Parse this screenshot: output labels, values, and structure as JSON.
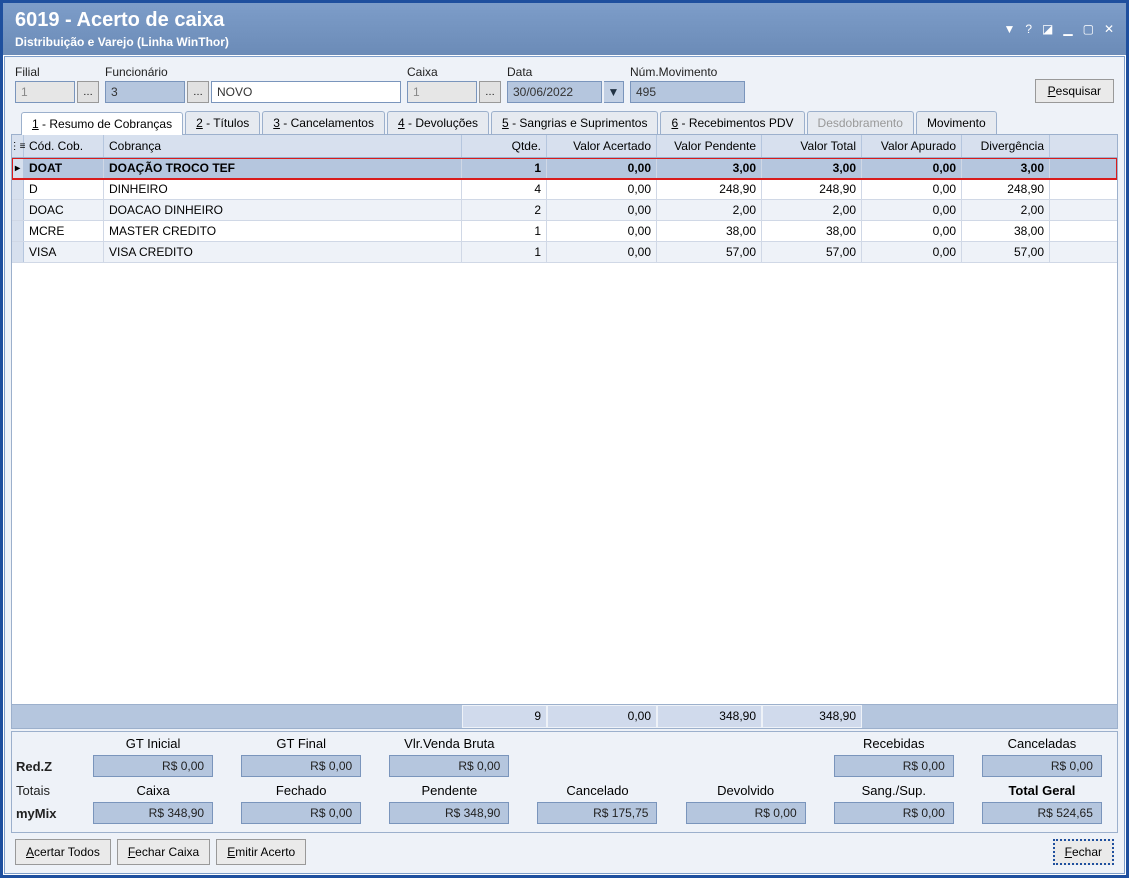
{
  "window": {
    "title": "6019 - Acerto de caixa",
    "subtitle": "Distribuição e Varejo (Linha WinThor)"
  },
  "form": {
    "filial_label": "Filial",
    "filial_value": "1",
    "funcionario_label": "Funcionário",
    "funcionario_value": "3",
    "funcionario_name": "NOVO",
    "caixa_label": "Caixa",
    "caixa_value": "1",
    "data_label": "Data",
    "data_value": "30/06/2022",
    "num_mov_label": "Núm.Movimento",
    "num_mov_value": "495",
    "pesquisar": "Pesquisar"
  },
  "tabs": [
    {
      "n": "1",
      "label": " - Resumo de Cobranças",
      "active": true
    },
    {
      "n": "2",
      "label": " - Títulos"
    },
    {
      "n": "3",
      "label": " - Cancelamentos"
    },
    {
      "n": "4",
      "label": " - Devoluções"
    },
    {
      "n": "5",
      "label": " - Sangrias e Suprimentos"
    },
    {
      "n": "6",
      "label": " - Recebimentos PDV"
    },
    {
      "n": "",
      "label": "Desdobramento",
      "disabled": true
    },
    {
      "n": "",
      "label": "Movimento"
    }
  ],
  "grid": {
    "headers": {
      "cod": "Cód. Cob.",
      "cob": "Cobrança",
      "qtde": "Qtde.",
      "va": "Valor Acertado",
      "vp": "Valor Pendente",
      "vt": "Valor Total",
      "vap": "Valor Apurado",
      "div": "Divergência"
    },
    "rows": [
      {
        "cod": "DOAT",
        "cob": "DOAÇÃO TROCO TEF",
        "qtde": "1",
        "va": "0,00",
        "vp": "3,00",
        "vt": "3,00",
        "vap": "0,00",
        "div": "3,00",
        "highlighted": true
      },
      {
        "cod": "D",
        "cob": "DINHEIRO",
        "qtde": "4",
        "va": "0,00",
        "vp": "248,90",
        "vt": "248,90",
        "vap": "0,00",
        "div": "248,90"
      },
      {
        "cod": "DOAC",
        "cob": "DOACAO DINHEIRO",
        "qtde": "2",
        "va": "0,00",
        "vp": "2,00",
        "vt": "2,00",
        "vap": "0,00",
        "div": "2,00"
      },
      {
        "cod": "MCRE",
        "cob": "MASTER CREDITO",
        "qtde": "1",
        "va": "0,00",
        "vp": "38,00",
        "vt": "38,00",
        "vap": "0,00",
        "div": "38,00"
      },
      {
        "cod": "VISA",
        "cob": "VISA CREDITO",
        "qtde": "1",
        "va": "0,00",
        "vp": "57,00",
        "vt": "57,00",
        "vap": "0,00",
        "div": "57,00"
      }
    ],
    "footer": {
      "qtde": "9",
      "va": "0,00",
      "vp": "348,90",
      "vt": "348,90"
    }
  },
  "summary": {
    "redz_label": "Red.Z",
    "totais_label": "Totais",
    "mymix_label": "myMix",
    "gt_inicial_label": "GT Inicial",
    "gt_inicial_value": "R$ 0,00",
    "gt_final_label": "GT Final",
    "gt_final_value": "R$ 0,00",
    "vlr_venda_label": "Vlr.Venda Bruta",
    "vlr_venda_value": "R$ 0,00",
    "recebidas_label": "Recebidas",
    "recebidas_value": "R$ 0,00",
    "canceladas_label": "Canceladas",
    "canceladas_value": "R$ 0,00",
    "caixa_label": "Caixa",
    "caixa_value": "R$ 348,90",
    "fechado_label": "Fechado",
    "fechado_value": "R$ 0,00",
    "pendente_label": "Pendente",
    "pendente_value": "R$ 348,90",
    "cancelado_label": "Cancelado",
    "cancelado_value": "R$ 175,75",
    "devolvido_label": "Devolvido",
    "devolvido_value": "R$ 0,00",
    "sang_label": "Sang./Sup.",
    "sang_value": "R$ 0,00",
    "total_geral_label": "Total Geral",
    "total_geral_value": "R$ 524,65"
  },
  "buttons": {
    "acertar": "Acertar Todos",
    "fechar_caixa": "Fechar Caixa",
    "emitir": "Emitir Acerto",
    "fechar": "echar",
    "fechar_u": "F"
  }
}
